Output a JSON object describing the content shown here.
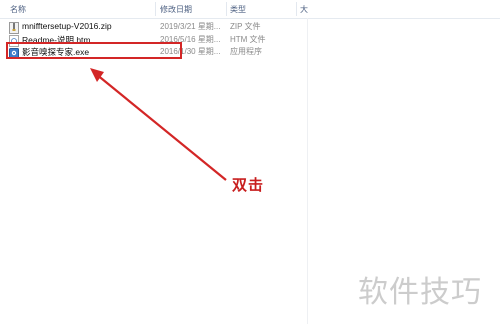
{
  "columns": {
    "name": "名称",
    "date": "修改日期",
    "type": "类型",
    "size": "大"
  },
  "files": [
    {
      "name": "mnifftersetup-V2016.zip",
      "date": "2019/3/21 星期...",
      "type": "ZIP 文件",
      "icon": "zip-file-icon"
    },
    {
      "name": "Readme-说明.htm",
      "date": "2016/5/16 星期...",
      "type": "HTM 文件",
      "icon": "htm-file-icon"
    },
    {
      "name": "影音嗅探专家.exe",
      "date": "2016/1/30 星期...",
      "type": "应用程序",
      "icon": "exe-app-icon"
    }
  ],
  "annotation": {
    "callout": "双击",
    "color": "#d32626"
  },
  "watermark": "软件技巧"
}
